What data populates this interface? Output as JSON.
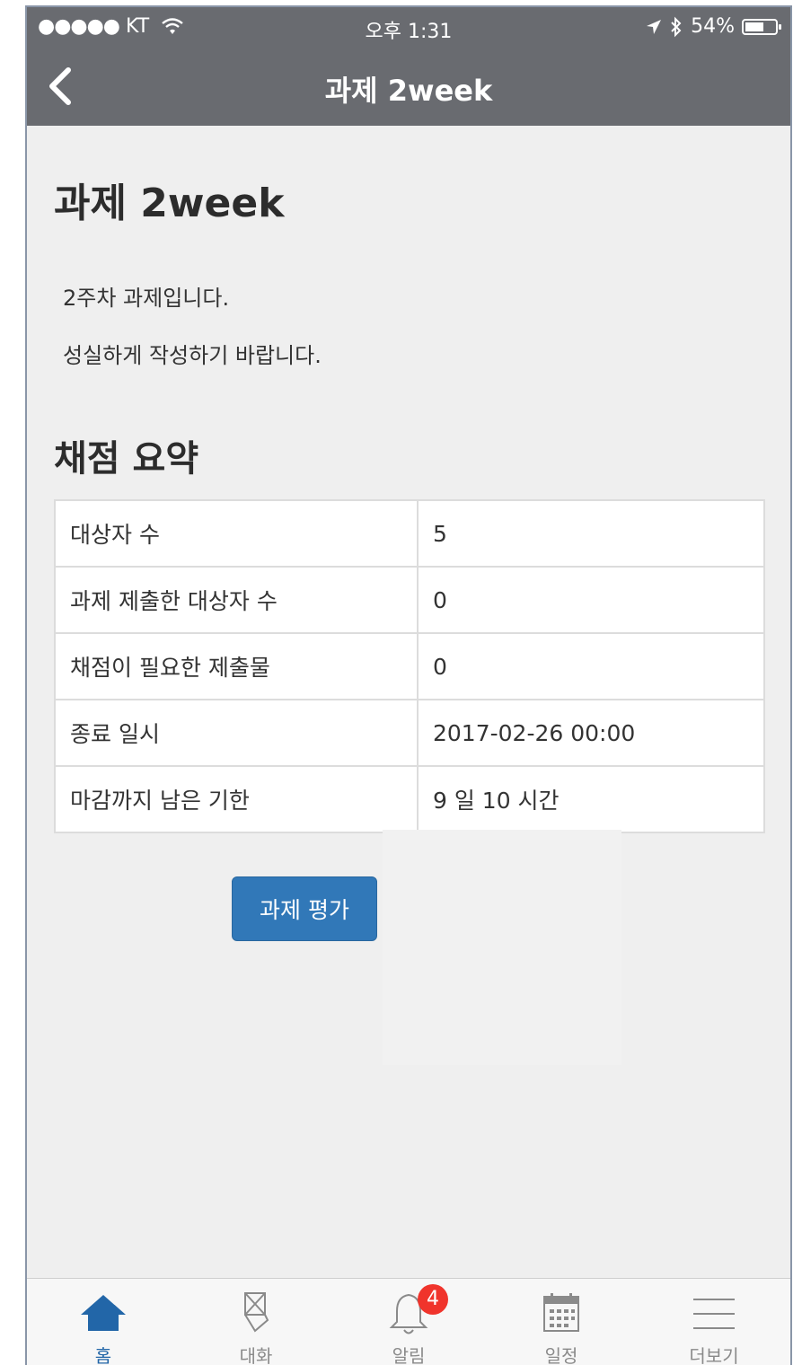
{
  "status": {
    "carrier_dots": "●●●●●",
    "carrier": "KT",
    "time": "오후 1:31",
    "battery": "54%"
  },
  "nav": {
    "title": "과제 2week"
  },
  "main": {
    "title": "과제 2week",
    "description": [
      "2주차 과제입니다.",
      "성실하게 작성하기 바랍니다."
    ],
    "summary_heading": "채점 요약",
    "summary_rows": [
      {
        "label": "대상자 수",
        "value": "5"
      },
      {
        "label": "과제 제출한 대상자 수",
        "value": "0"
      },
      {
        "label": "채점이 필요한 제출물",
        "value": "0"
      },
      {
        "label": "종료 일시",
        "value": "2017-02-26 00:00"
      },
      {
        "label": "마감까지 남은 기한",
        "value": "9 일 10 시간"
      }
    ],
    "evaluate_button": "과제 평가"
  },
  "tabs": [
    {
      "label": "홈",
      "icon": "home-icon",
      "active": true
    },
    {
      "label": "대화",
      "icon": "chat-icon"
    },
    {
      "label": "알림",
      "icon": "bell-icon",
      "badge": "4"
    },
    {
      "label": "일정",
      "icon": "calendar-icon"
    },
    {
      "label": "더보기",
      "icon": "menu-icon"
    }
  ],
  "colors": {
    "header": "#696b70",
    "accent": "#3178b8",
    "active_tab": "#2266a8",
    "badge": "#f0342c"
  }
}
